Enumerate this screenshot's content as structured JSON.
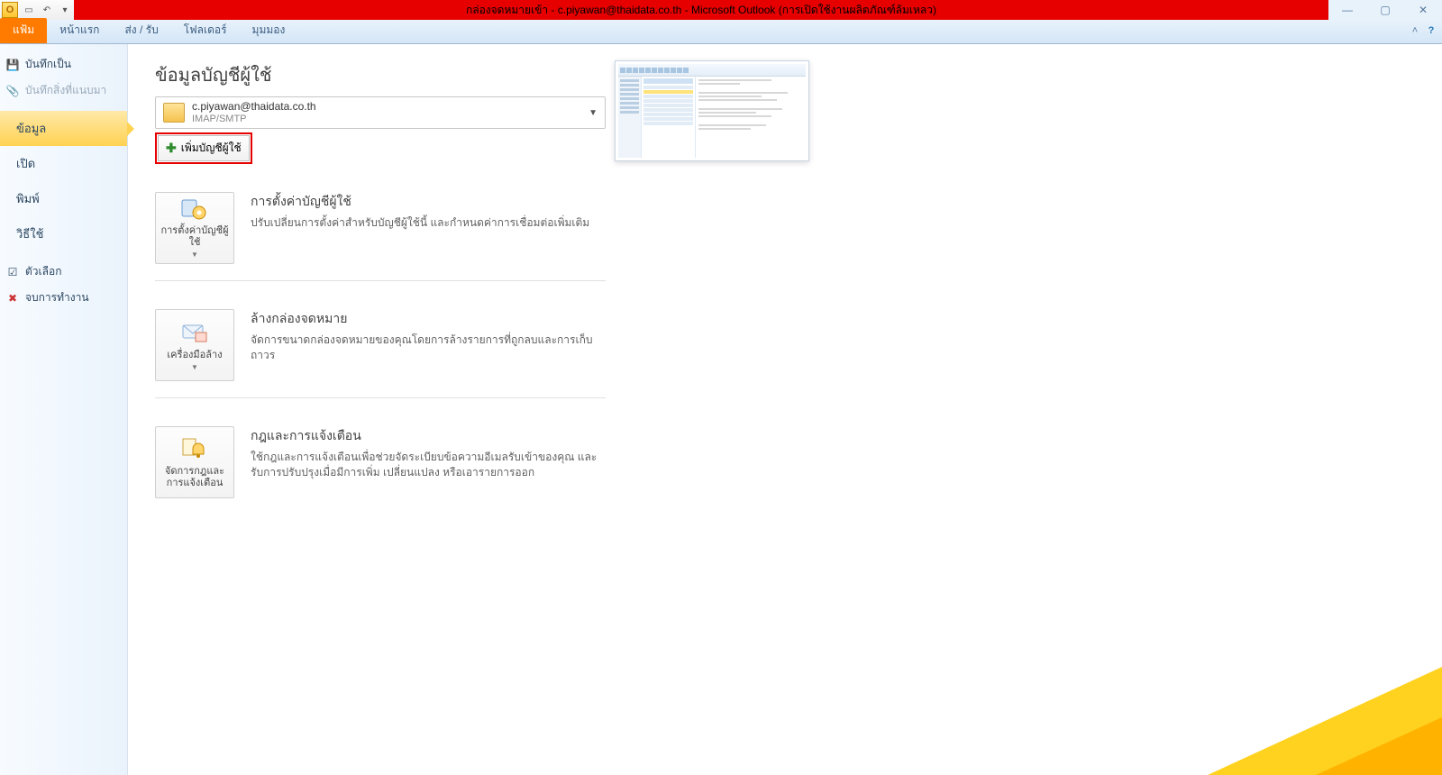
{
  "titlebar": {
    "logo_letter": "O",
    "title": "กล่องจดหมายเข้า - c.piyawan@thaidata.co.th - Microsoft Outlook (การเปิดใช้งานผลิตภัณฑ์ล้มเหลว)"
  },
  "tabs": {
    "file": "แฟ้ม",
    "home": "หน้าแรก",
    "sendreceive": "ส่ง / รับ",
    "folder": "โฟลเดอร์",
    "view": "มุมมอง"
  },
  "sidebar": {
    "save_as": "บันทึกเป็น",
    "save_attachments": "บันทึกสิ่งที่แนบมา",
    "info": "ข้อมูล",
    "open": "เปิด",
    "print": "พิมพ์",
    "help": "วิธีใช้",
    "options": "ตัวเลือก",
    "exit": "จบการทำงาน"
  },
  "content": {
    "heading": "ข้อมูลบัญชีผู้ใช้",
    "account_email": "c.piyawan@thaidata.co.th",
    "account_protocol": "IMAP/SMTP",
    "add_account": "เพิ่มบัญชีผู้ใช้",
    "sections": [
      {
        "button": "การตั้งค่าบัญชีผู้ใช้",
        "title": "การตั้งค่าบัญชีผู้ใช้",
        "desc": "ปรับเปลี่ยนการตั้งค่าสำหรับบัญชีผู้ใช้นี้ และกำหนดค่าการเชื่อมต่อเพิ่มเติม"
      },
      {
        "button": "เครื่องมือล้าง",
        "title": "ล้างกล่องจดหมาย",
        "desc": "จัดการขนาดกล่องจดหมายของคุณโดยการล้างรายการที่ถูกลบและการเก็บถาวร"
      },
      {
        "button": "จัดการกฎและการแจ้งเตือน",
        "title": "กฎและการแจ้งเตือน",
        "desc": "ใช้กฎและการแจ้งเตือนเพื่อช่วยจัดระเบียบข้อความอีเมลรับเข้าของคุณ และรับการปรับปรุงเมื่อมีการเพิ่ม เปลี่ยนแปลง หรือเอารายการออก"
      }
    ]
  }
}
